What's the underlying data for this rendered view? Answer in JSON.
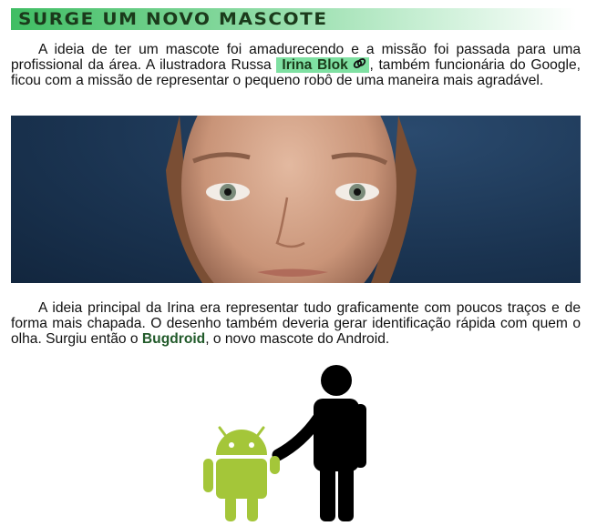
{
  "section": {
    "title": "Surge um novo mascote"
  },
  "paragraph1": {
    "before_link": "A ideia de ter um mascote foi amadurecendo e a missão foi passada para uma profissional da área. A ilustradora Russa ",
    "link_text": "Irina Blok",
    "link_icon": "link-icon",
    "after_link": ", também funcionária do Google, ficou com a missão de representar o pequeno robô de uma maneira mais agradável."
  },
  "paragraph2": {
    "before_name": "A ideia principal da Irina era representar tudo graficamente com poucos traços e de forma mais chapada. O desenho também deveria gerar identificação rápida com quem o olha. Surgiu então o ",
    "mascot_name": "Bugdroid",
    "after_name": ", o novo mascote do Android."
  },
  "colors": {
    "heading_gradient_start": "#3fbd63",
    "link_highlight": "#7fe0a2",
    "mascot_name": "#215a2a",
    "android_green": "#a4c639",
    "silhouette": "#000000",
    "photo_background": "#1a3350"
  }
}
